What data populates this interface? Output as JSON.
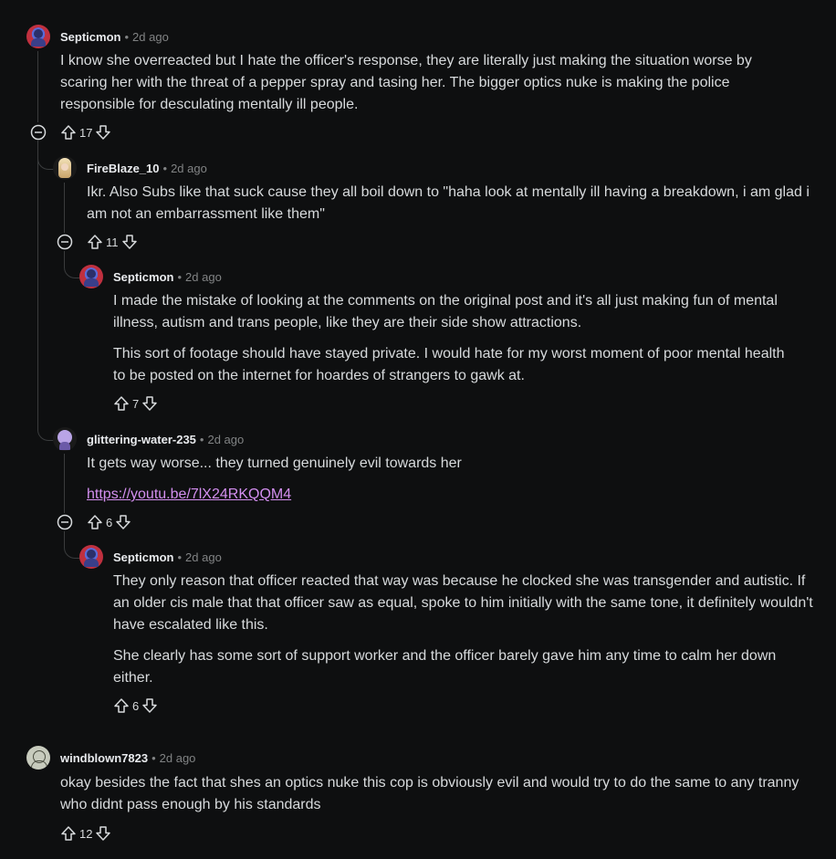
{
  "comments": [
    {
      "user": "Septicmon",
      "time": "2d ago",
      "paragraphs": [
        "I know she overreacted but I hate the officer's response, they are literally just making the situation worse by scaring her with the threat of a pepper spray and tasing her. The bigger optics nuke is making the police responsible for desculating mentally ill people."
      ],
      "votes": "17"
    },
    {
      "user": "FireBlaze_10",
      "time": "2d ago",
      "paragraphs": [
        "Ikr. Also Subs like that suck cause they all boil down to \"haha look at mentally ill having a breakdown, i am glad i am not an embarrassment like them\""
      ],
      "votes": "11"
    },
    {
      "user": "Septicmon",
      "time": "2d ago",
      "paragraphs": [
        "I made the mistake of looking at the comments on the original post and it's all just making fun of mental illness, autism and trans people, like they are their side show attractions.",
        "This sort of footage should have stayed private. I would hate for my worst moment of poor mental health to be posted on the internet for hoardes of strangers to gawk at."
      ],
      "votes": "7"
    },
    {
      "user": "glittering-water-235",
      "time": "2d ago",
      "paragraphs": [
        "It gets way worse... they turned genuinely evil towards her"
      ],
      "link": "https://youtu.be/7lX24RKQQM4",
      "votes": "6"
    },
    {
      "user": "Septicmon",
      "time": "2d ago",
      "paragraphs": [
        "They only reason that officer reacted that way was because he clocked she was transgender and autistic. If an older cis male that that officer saw as equal, spoke to him initially with the same tone, it definitely wouldn't have escalated like this.",
        "She clearly has some sort of support worker and the officer barely gave him any time to calm her down either."
      ],
      "votes": "6"
    },
    {
      "user": "windblown7823",
      "time": "2d ago",
      "paragraphs": [
        "okay besides the fact that shes an optics nuke this cop is obviously evil and would try to do the same to any tranny who didnt pass enough by his standards"
      ],
      "votes": "12"
    }
  ],
  "separator": "•",
  "icons": {
    "upvote": "upvote-arrow-icon",
    "downvote": "downvote-arrow-icon",
    "collapse": "collapse-minus-icon"
  },
  "colors": {
    "background": "#0e0f10",
    "text": "#d7dadc",
    "meta": "#818384",
    "link": "#d48ff0",
    "thread_line": "#3a3c3d"
  }
}
